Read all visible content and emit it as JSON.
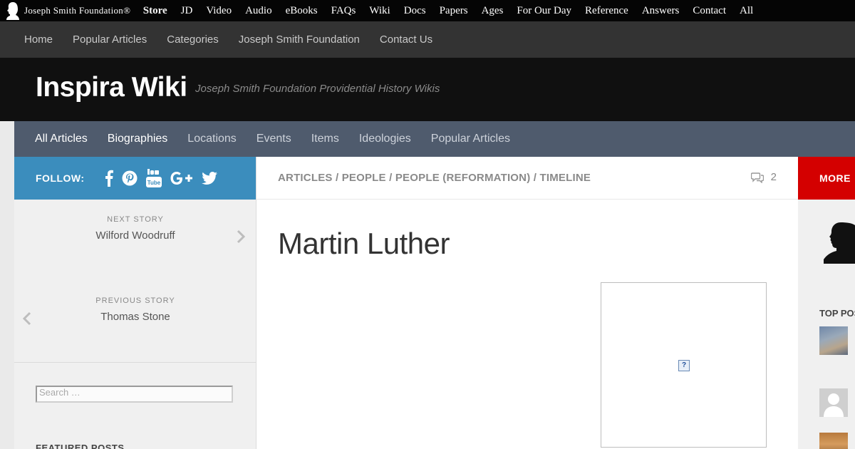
{
  "topbar": {
    "brand": "Joseph Smith Foundation®",
    "nav": [
      "Store",
      "JD",
      "Video",
      "Audio",
      "eBooks",
      "FAQs",
      "Wiki",
      "Docs",
      "Papers",
      "Ages",
      "For Our Day",
      "Reference",
      "Answers",
      "Contact",
      "All"
    ]
  },
  "subnav": [
    "Home",
    "Popular Articles",
    "Categories",
    "Joseph Smith Foundation",
    "Contact Us"
  ],
  "header": {
    "title": "Inspira Wiki",
    "description": "Joseph Smith Foundation Providential History Wikis"
  },
  "mainnav": [
    "All Articles",
    "Biographies",
    "Locations",
    "Events",
    "Items",
    "Ideologies",
    "Popular Articles"
  ],
  "follow": {
    "label": "FOLLOW:",
    "icons": [
      "facebook-icon",
      "pinterest-icon",
      "youtube-icon",
      "google-plus-icon",
      "twitter-icon"
    ]
  },
  "story_nav": {
    "next_kicker": "NEXT STORY",
    "next_title": "Wilford Woodruff",
    "prev_kicker": "PREVIOUS STORY",
    "prev_title": "Thomas Stone"
  },
  "search": {
    "placeholder": "Search …"
  },
  "featured_heading": "FEATURED POSTS",
  "breadcrumb": "ARTICLES / PEOPLE / PEOPLE (REFORMATION) / TIMELINE",
  "comments_count": "2",
  "article": {
    "title": "Martin Luther"
  },
  "image": {
    "broken_glyph": "?"
  },
  "more_label": "MORE",
  "top_posts_heading": "TOP POS",
  "colors": {
    "follow_bar": "#3b8dbd",
    "more_bar": "#d40000",
    "main_nav": "#4f5b6d",
    "header": "#101010"
  }
}
